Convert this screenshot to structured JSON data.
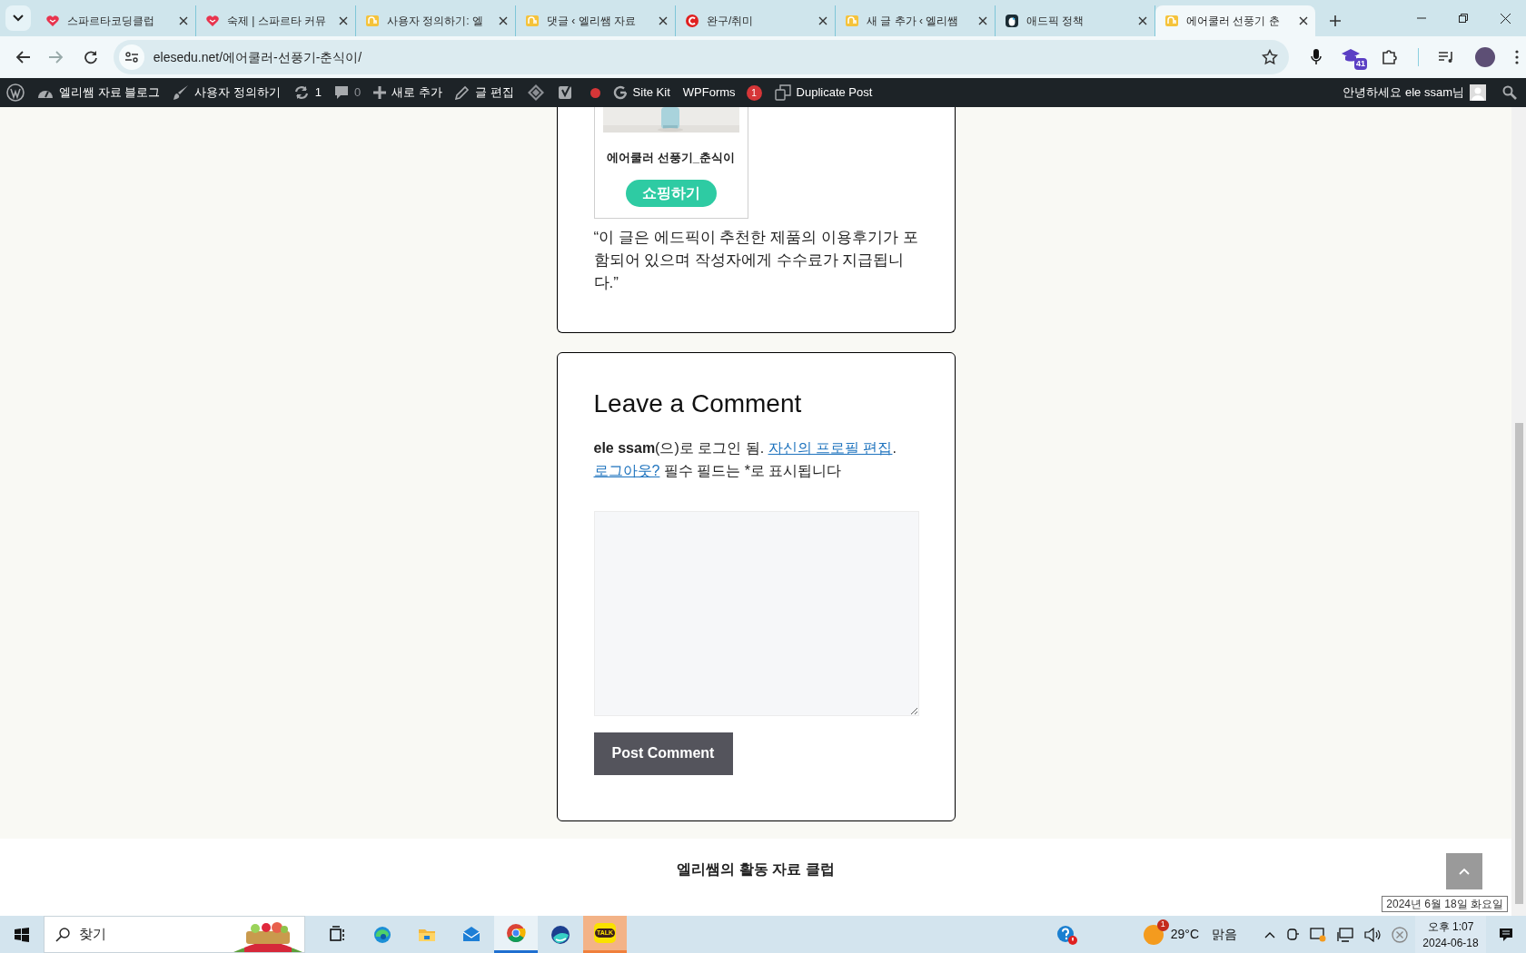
{
  "browser": {
    "tabs": [
      {
        "title": "스파르타코딩클럽",
        "kind": "heart",
        "selected": false
      },
      {
        "title": "숙제 | 스파르타 커뮤",
        "kind": "heart",
        "selected": false
      },
      {
        "title": "사용자 정의하기: 엘",
        "kind": "elephant",
        "selected": false
      },
      {
        "title": "댓글 ‹ 엘리쌤 자료 ",
        "kind": "elephant",
        "selected": false
      },
      {
        "title": "완구/취미",
        "kind": "circle-c",
        "selected": false
      },
      {
        "title": "새 글 추가 ‹ 엘리쌤",
        "kind": "elephant",
        "selected": false
      },
      {
        "title": "애드픽 정책",
        "kind": "penguin",
        "selected": false
      },
      {
        "title": "에어쿨러 선풍기 춘",
        "kind": "elephant",
        "selected": true
      }
    ],
    "address": "elesedu.net/에어쿨러-선풍기-춘식이/",
    "extension_badge": "41"
  },
  "admin_bar": {
    "items": [
      {
        "kind": "wordpress"
      },
      {
        "kind": "dashboard",
        "label": "엘리쌤 자료 블로그"
      },
      {
        "kind": "brush",
        "label": "사용자 정의하기"
      },
      {
        "kind": "updates",
        "label": "1"
      },
      {
        "kind": "comment",
        "label": "0",
        "disabled": true
      },
      {
        "kind": "plus",
        "label": "새로 추가"
      },
      {
        "kind": "pencil",
        "label": "글 편집"
      },
      {
        "kind": "diamond"
      },
      {
        "kind": "yoast",
        "alert": true
      },
      {
        "kind": "google",
        "label": "Site Kit"
      },
      {
        "kind": "text",
        "label": "WPForms",
        "badge": "1"
      },
      {
        "kind": "copy",
        "label": "Duplicate Post"
      }
    ],
    "greeting": "안녕하세요 ele ssam님"
  },
  "post": {
    "product": {
      "name": "에어쿨러 선풍기_춘식이",
      "button": "쇼핑하기"
    },
    "disclosure": "“이 글은 에드픽이 추천한 제품의 이용후기가 포함되어 있으며 작성자에게 수수료가 지급됩니다.”"
  },
  "comment_form": {
    "title": "Leave a Comment",
    "note": [
      {
        "kind": "text",
        "text": "**ele ssam**(으)로 로그인 됨. "
      },
      {
        "kind": "link",
        "text": "자신의 프로필 편집"
      },
      {
        "kind": "text",
        "text": ". "
      },
      {
        "kind": "link",
        "text": "로그아웃?"
      },
      {
        "kind": "text",
        "text": " 필수 필드는 *로 표시됩니다"
      }
    ],
    "submit": "Post Comment"
  },
  "footer": {
    "text": "엘리쌤의 활동 자료 클럽"
  },
  "taskbar": {
    "search_label": "찾기",
    "apps": [
      {
        "kind": "task-view",
        "selected": false,
        "flashing": false
      },
      {
        "kind": "edge",
        "selected": false,
        "flashing": false
      },
      {
        "kind": "folder",
        "selected": false,
        "flashing": false
      },
      {
        "kind": "mail",
        "selected": false,
        "flashing": false
      },
      {
        "kind": "chrome",
        "selected": true,
        "flashing": false
      },
      {
        "kind": "whale",
        "selected": false,
        "flashing": false
      },
      {
        "kind": "kakao",
        "label": "TALK",
        "selected": false,
        "flashing": true
      }
    ],
    "weather": {
      "temp": "29°C",
      "condition": "맑음",
      "badge": "1"
    },
    "time": "오후 1:07",
    "date": "2024-06-18",
    "tooltip": "2024년 6월 18일 화요일"
  }
}
